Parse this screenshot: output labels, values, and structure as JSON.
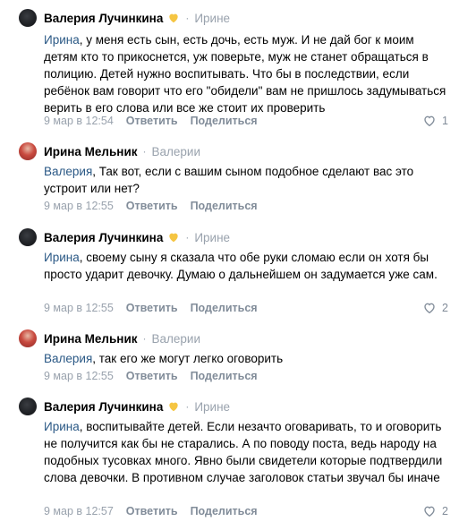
{
  "comments": [
    {
      "author": "Валерия Лучинкина",
      "author_badge": "heart",
      "separator": "·",
      "reply_to": "Ирине",
      "mention": "Ирина",
      "text": ", у меня есть сын, есть дочь, есть муж. И не дай бог к моим детям кто то прикоснется, уж поверьте, муж не станет обращаться в полицию. Детей нужно воспитывать. Что бы в последствии, если ребёнок вам говорит что его \"обидели\" вам не пришлось задумываться верить в его слова или все же стоит их проверить",
      "date": "9 мар в 12:54",
      "reply_label": "Ответить",
      "share_label": "Поделиться",
      "likes": "1"
    },
    {
      "author": "Ирина Мельник",
      "separator": "·",
      "reply_to": "Валерии",
      "mention": "Валерия",
      "text": ", Так вот, если с вашим сыном подобное сделают вас это устроит или нет?",
      "date": "9 мар в 12:55",
      "reply_label": "Ответить",
      "share_label": "Поделиться",
      "likes": ""
    },
    {
      "author": "Валерия Лучинкина",
      "author_badge": "heart",
      "separator": "·",
      "reply_to": "Ирине",
      "mention": "Ирина",
      "text": ", своему сыну я сказала что обе руки сломаю если он хотя бы просто ударит девочку. Думаю о дальнейшем он задумается уже сам.",
      "date": "9 мар в 12:55",
      "reply_label": "Ответить",
      "share_label": "Поделиться",
      "likes": "2"
    },
    {
      "author": "Ирина Мельник",
      "separator": "·",
      "reply_to": "Валерии",
      "mention": "Валерия",
      "text": ", так его же могут легко оговорить",
      "date": "9 мар в 12:55",
      "reply_label": "Ответить",
      "share_label": "Поделиться",
      "likes": ""
    },
    {
      "author": "Валерия Лучинкина",
      "author_badge": "heart",
      "separator": "·",
      "reply_to": "Ирине",
      "mention": "Ирина",
      "text": ", воспитывайте детей. Если незачто оговаривать, то и оговорить не получится как бы не старались. А по поводу поста, ведь народу на подобных тусовках много. Явно были свидетели которые подтвердили слова девочки. В противном случае заголовок статьи звучал бы иначе",
      "date": "9 мар в 12:57",
      "reply_label": "Ответить",
      "share_label": "Поделиться",
      "likes": "2"
    }
  ],
  "colors": {
    "link": "#2a5885",
    "secondary": "#99a2ad",
    "action": "#818c99",
    "heart": "#f5c542"
  }
}
